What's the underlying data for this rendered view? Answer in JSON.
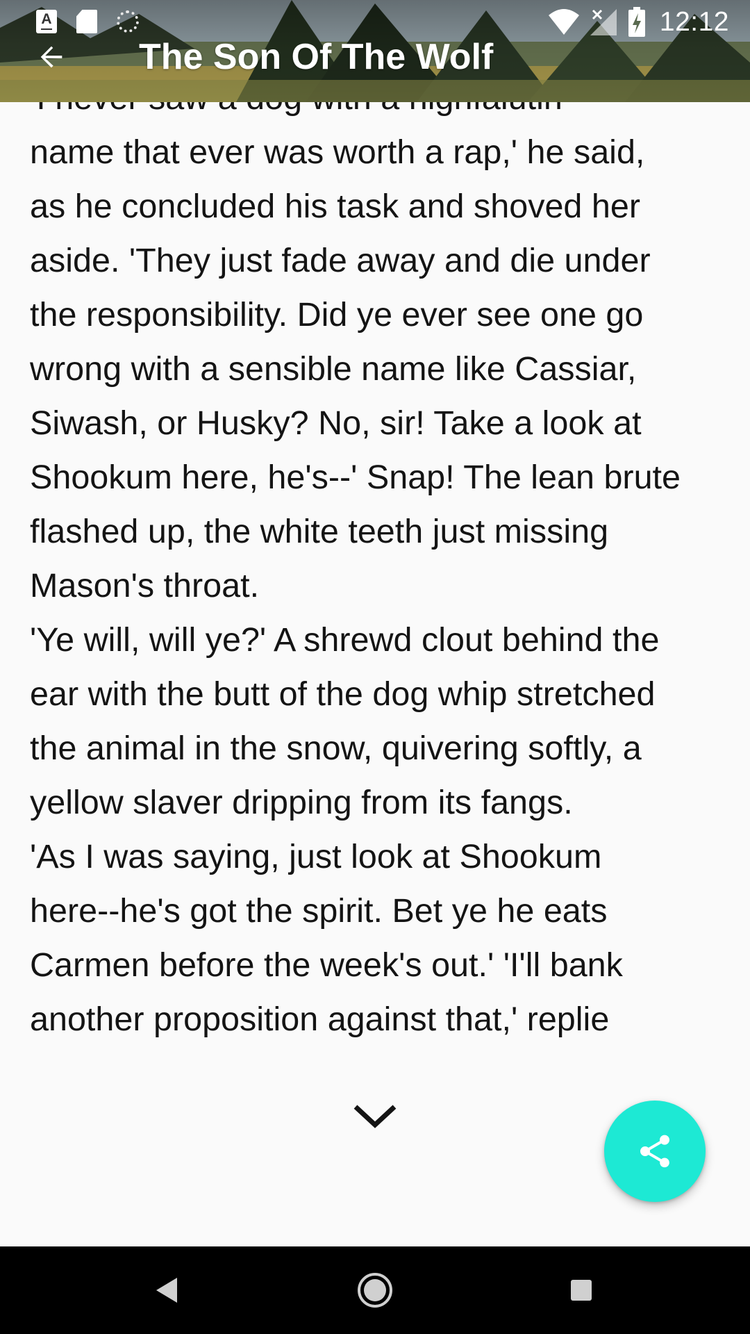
{
  "status_bar": {
    "time": "12:12",
    "notification_icons": [
      "text-a-icon",
      "sd-card-icon",
      "sync-icon"
    ],
    "system_icons": [
      "wifi-icon",
      "no-signal-icon",
      "battery-charging-icon"
    ]
  },
  "app_bar": {
    "title": "The Son Of The Wolf",
    "back_icon": "arrow-back-icon"
  },
  "reader": {
    "text": "'I never saw a dog with a highfalutin\nname that ever was worth a rap,' he said,\nas he concluded his task and shoved her\naside. 'They just fade away and die under\nthe responsibility. Did ye ever see one go\nwrong with a sensible name like Cassiar,\nSiwash, or Husky? No, sir! Take a look at\nShookum here, he's--' Snap! The lean brute\nflashed up, the white teeth just missing\nMason's throat.\n'Ye will, will ye?' A shrewd clout behind the\near with the butt of the dog whip stretched\nthe animal in the snow, quivering softly, a\nyellow slaver dripping from its fangs.\n'As I was saying, just look at Shookum\nhere--he's got the spirit. Bet ye he eats\nCarmen before the week's out.' 'I'll bank\nanother proposition against that,' replie",
    "scroll_icon": "chevron-down-icon"
  },
  "fab": {
    "icon": "share-icon",
    "color": "#1de9d4"
  },
  "nav_bar": {
    "buttons": [
      "nav-back-icon",
      "nav-home-icon",
      "nav-recents-icon"
    ]
  }
}
